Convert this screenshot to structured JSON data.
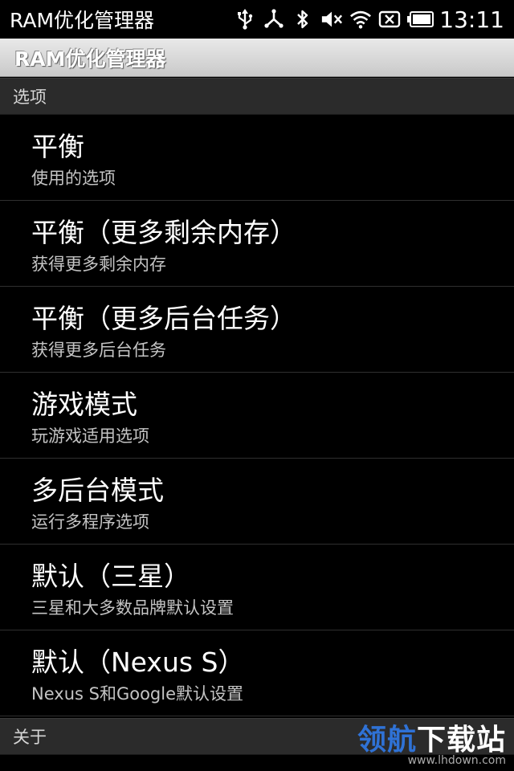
{
  "status_bar": {
    "app_name": "RAM优化管理器",
    "time": "13:11"
  },
  "title_bar": {
    "title": "RAM优化管理器"
  },
  "categories": {
    "options": "选项",
    "about": "关于"
  },
  "options": [
    {
      "title": "平衡",
      "summary": "使用的选项"
    },
    {
      "title": "平衡（更多剩余内存）",
      "summary": "获得更多剩余内存"
    },
    {
      "title": "平衡（更多后台任务）",
      "summary": "获得更多后台任务"
    },
    {
      "title": "游戏模式",
      "summary": "玩游戏适用选项"
    },
    {
      "title": "多后台模式",
      "summary": "运行多程序选项"
    },
    {
      "title": "默认（三星）",
      "summary": "三星和大多数品牌默认设置"
    },
    {
      "title": "默认（Nexus S）",
      "summary": "Nexus S和Google默认设置"
    }
  ],
  "watermark": {
    "text_a": "领航",
    "text_b": "下载站",
    "url": "www.lhdown.com"
  },
  "icons": {
    "usb": "usb-icon",
    "usb_debug": "usb-debug-icon",
    "bluetooth": "bluetooth-icon",
    "mute": "volume-mute-icon",
    "wifi": "wifi-icon",
    "no_sim": "no-sim-icon",
    "battery": "battery-icon"
  }
}
